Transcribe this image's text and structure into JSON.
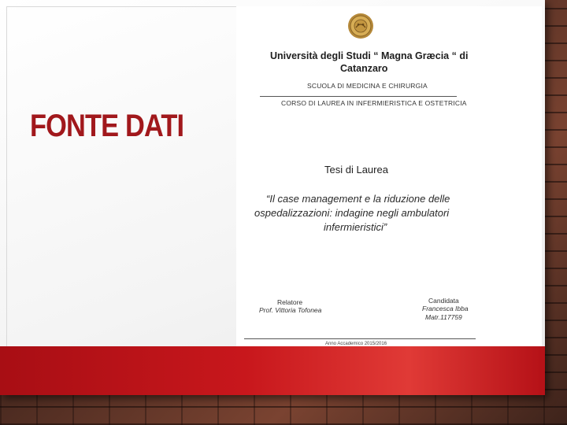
{
  "slide": {
    "heading": "FONTE DATI"
  },
  "document": {
    "university_line1": "Università degli Studi “ Magna Græcia “ di",
    "university_line2": "Catanzaro",
    "school": "SCUOLA DI MEDICINA E CHIRURGIA",
    "course": "CORSO DI LAUREA IN INFERMIERISTICA E OSTETRICIA",
    "thesis_label": "Tesi di Laurea",
    "title_lines": [
      "“Il case management e la riduzione delle",
      "ospedalizzazioni: indagine negli ambulatori",
      "infermieristici”"
    ],
    "relatore_label": "Relatore",
    "relatore_name": "Prof. Vittoria Tofonea",
    "candidata_label": "Candidata",
    "candidata_name": "Francesca Ibba",
    "candidata_matr": "Matr.117759",
    "anno_accademico": "Anno Accademico 2015/2016"
  },
  "colors": {
    "heading": "#a1181c",
    "band": "#c8171c",
    "background_brick": "#5a3326"
  },
  "icons": {
    "seal": "university-seal-icon"
  }
}
